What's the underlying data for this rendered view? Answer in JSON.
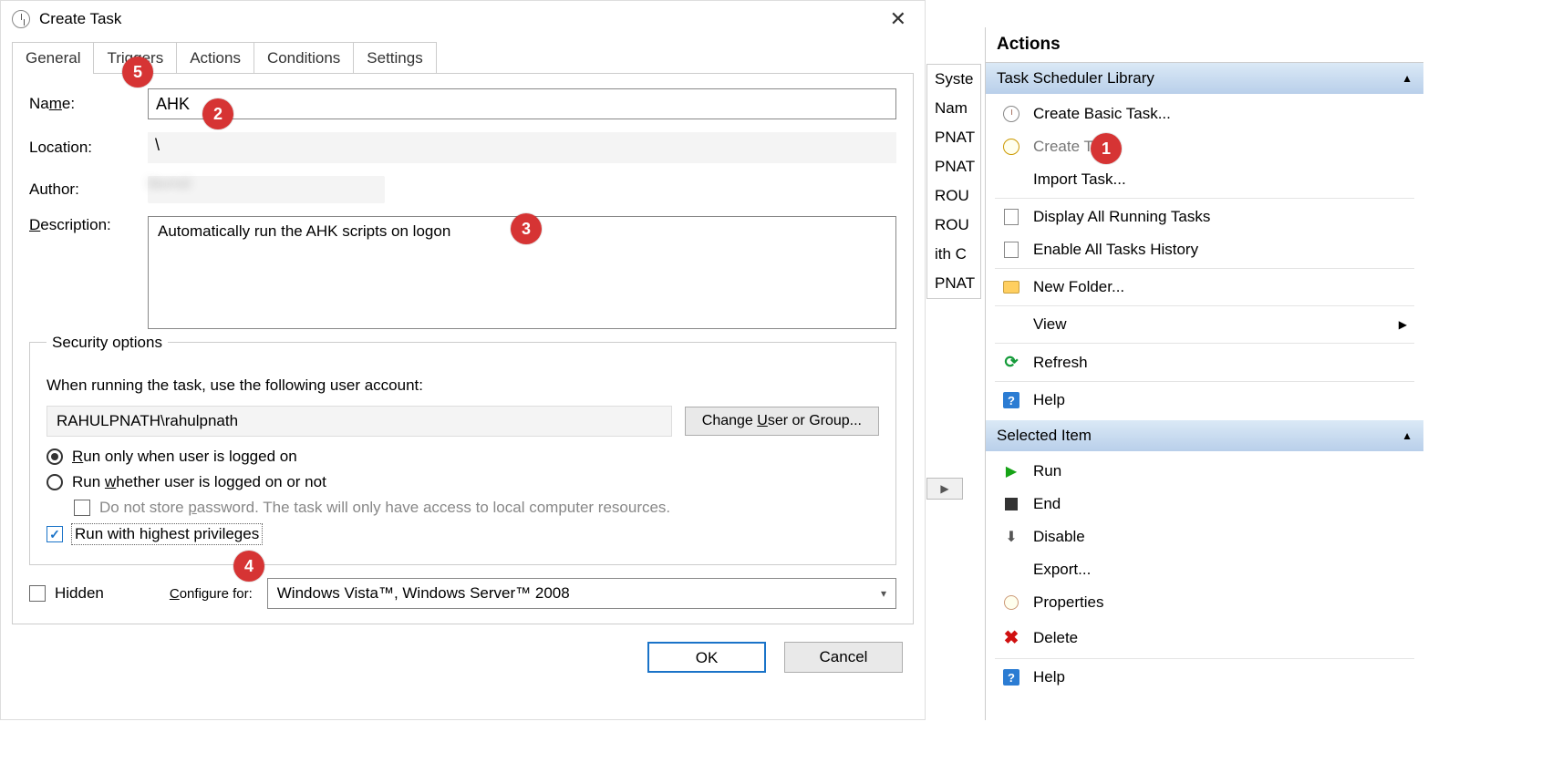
{
  "dialog": {
    "title": "Create Task",
    "tabs": {
      "general": "General",
      "triggers": "Triggers",
      "actions": "Actions",
      "conditions": "Conditions",
      "settings": "Settings"
    },
    "form": {
      "name_label_pre": "Na",
      "name_label_ul": "m",
      "name_label_post": "e:",
      "name_value": "AHK",
      "location_label": "Location:",
      "location_value": "\\",
      "author_label": "Author:",
      "description_label_ul": "D",
      "description_label_post": "escription:",
      "description_value": "Automatically run the AHK scripts on logon"
    },
    "security": {
      "legend": "Security options",
      "prompt": "When running the task, use the following user account:",
      "account": "RAHULPNATH\\rahulpnath",
      "change_btn_pre": "Change ",
      "change_btn_ul": "U",
      "change_btn_post": "ser or Group...",
      "radio1_ul": "R",
      "radio1_post": "un only when user is logged on",
      "radio2_pre": "Run ",
      "radio2_ul": "w",
      "radio2_post": "hether user is logged on or not",
      "nostore_pre": "Do not store ",
      "nostore_ul": "p",
      "nostore_post": "assword.  The task will only have access to local computer resources.",
      "highpriv_label": "Run with highest privileges"
    },
    "bottom": {
      "hidden_label": "Hidden",
      "configure_label_ul": "C",
      "configure_label_post": "onfigure for:",
      "configure_value": "Windows Vista™, Windows Server™ 2008"
    },
    "footer": {
      "ok": "OK",
      "cancel": "Cancel"
    }
  },
  "callouts": {
    "c1": "1",
    "c2": "2",
    "c3": "3",
    "c4": "4",
    "c5": "5"
  },
  "bg_rows": [
    "Syste",
    "Nam",
    "PNAT",
    "PNAT",
    "ROU",
    "ROU",
    "ith C",
    "PNAT"
  ],
  "actions_pane": {
    "title": "Actions",
    "section1": "Task Scheduler Library",
    "items1": {
      "create_basic": "Create Basic Task...",
      "create_task_pre": "Create T",
      "create_task_post": "...",
      "import": "Import Task...",
      "display_running": "Display All Running Tasks",
      "enable_history": "Enable All Tasks History",
      "new_folder": "New Folder...",
      "view": "View",
      "refresh": "Refresh",
      "help": "Help"
    },
    "section2": "Selected Item",
    "items2": {
      "run": "Run",
      "end": "End",
      "disable": "Disable",
      "export": "Export...",
      "properties": "Properties",
      "delete": "Delete",
      "help": "Help"
    }
  }
}
